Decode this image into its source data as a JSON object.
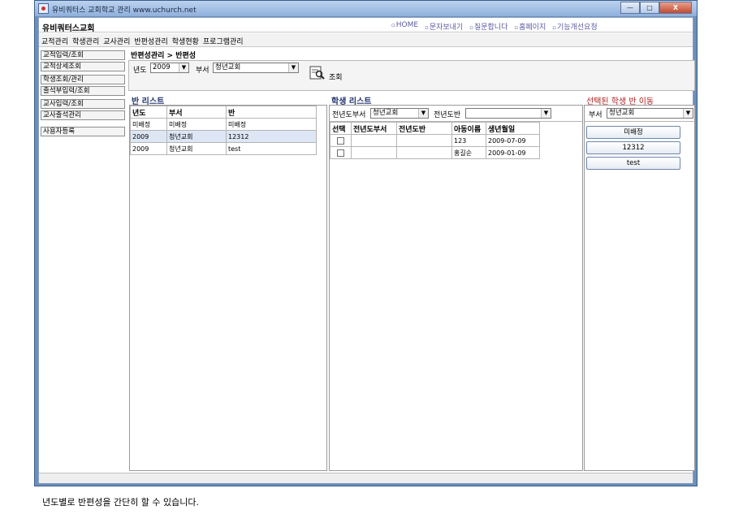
{
  "window": {
    "title": "유비쿼터스 교회학교 관리 www.uchurch.net",
    "controls": {
      "minimize": "—",
      "maximize": "□",
      "close": "X"
    }
  },
  "header": {
    "brand": "유비쿼터스교회",
    "links": [
      "HOME",
      "문자보내기",
      "질문합니다",
      "홈페이지",
      "기능개선요청"
    ]
  },
  "menu": [
    "교적관리",
    "학생관리",
    "교사관리",
    "반편성관리",
    "학생현황",
    "프로그램관리"
  ],
  "sidebar": [
    "교적입력/조회",
    "교적상세조회",
    "학생조회/관리",
    "출석부입력/조회",
    "교사입력/조회",
    "교사출석관리",
    "사용자등록"
  ],
  "breadcrumb": "반편성관리 > 반편성",
  "filter": {
    "year_label": "년도",
    "year_value": "2009",
    "dept_label": "부서",
    "dept_value": "청년교회",
    "search_label": "조회"
  },
  "class_list": {
    "title": "반 리스트",
    "columns": [
      "년도",
      "부서",
      "반"
    ],
    "rows": [
      [
        "미배정",
        "미배정",
        "미배정"
      ],
      [
        "2009",
        "청년교회",
        "12312"
      ],
      [
        "2009",
        "청년교회",
        "test"
      ]
    ]
  },
  "student_list": {
    "title": "학생 리스트",
    "prev_dept_label": "전년도부서",
    "prev_dept_value": "청년교회",
    "prev_class_label": "전년도반",
    "prev_class_value": "",
    "columns": [
      "선택",
      "전년도부서",
      "전년도반",
      "아동이름",
      "생년월일"
    ],
    "rows": [
      [
        "",
        "",
        "",
        "123",
        "2009-07-09"
      ],
      [
        "",
        "",
        "",
        "홍길순",
        "2009-01-09"
      ]
    ]
  },
  "move_panel": {
    "title": "선택된 학생 반 이동",
    "dept_label": "부서",
    "dept_value": "청년교회",
    "buttons": [
      "미배정",
      "12312",
      "test"
    ]
  },
  "caption": "년도별로 반편성을 간단히 할 수 있습니다.",
  "colors": {
    "window_frame": "#6d8fb8",
    "section_title": "#22336e",
    "move_title": "#b02020",
    "selected_row": "#dce6f4"
  }
}
